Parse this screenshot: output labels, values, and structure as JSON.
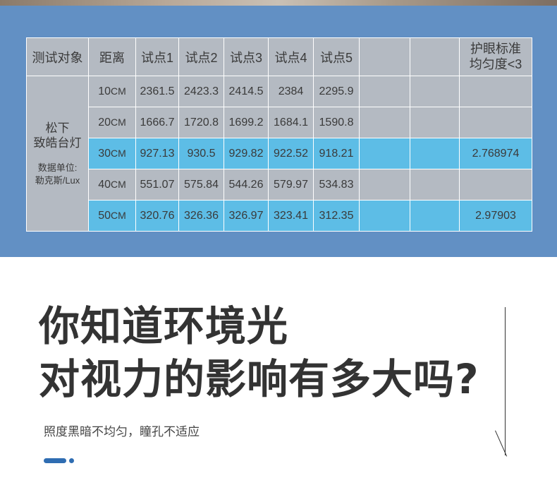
{
  "table": {
    "headers": [
      "测试对象",
      "距离",
      "试点1",
      "试点2",
      "试点3",
      "试点4",
      "试点5",
      "",
      "",
      "护眼标准\n均匀度<3"
    ],
    "standard_line1": "护眼标准",
    "standard_line2": "均匀度<3",
    "subject_name_line1": "松下",
    "subject_name_line2": "致皓台灯",
    "unit_line1": "数据单位:",
    "unit_line2": "勒克斯/Lux",
    "rows": [
      {
        "dist": "10",
        "unit": "CM",
        "values": [
          "2361.5",
          "2423.3",
          "2414.5",
          "2384",
          "2295.9"
        ],
        "ratio": "",
        "highlight": false
      },
      {
        "dist": "20",
        "unit": "CM",
        "values": [
          "1666.7",
          "1720.8",
          "1699.2",
          "1684.1",
          "1590.8"
        ],
        "ratio": "",
        "highlight": false
      },
      {
        "dist": "30",
        "unit": "CM",
        "values": [
          "927.13",
          "930.5",
          "929.82",
          "922.52",
          "918.21"
        ],
        "ratio": "2.768974",
        "highlight": true
      },
      {
        "dist": "40",
        "unit": "CM",
        "values": [
          "551.07",
          "575.84",
          "544.26",
          "579.97",
          "534.83"
        ],
        "ratio": "",
        "highlight": false
      },
      {
        "dist": "50",
        "unit": "CM",
        "values": [
          "320.76",
          "326.36",
          "326.97",
          "323.41",
          "312.35"
        ],
        "ratio": "2.97903",
        "highlight": true
      }
    ],
    "colors": {
      "header_gray": "#b4bac2",
      "highlight_blue": "#5dbde6",
      "panel_blue": "#6290c4"
    }
  },
  "headline": {
    "line1": "你知道环境光",
    "line2": "对视力的影响有多大吗?"
  },
  "subtext": "照度黑暗不均匀，瞳孔不适应",
  "accent_color": "#2f6db2"
}
